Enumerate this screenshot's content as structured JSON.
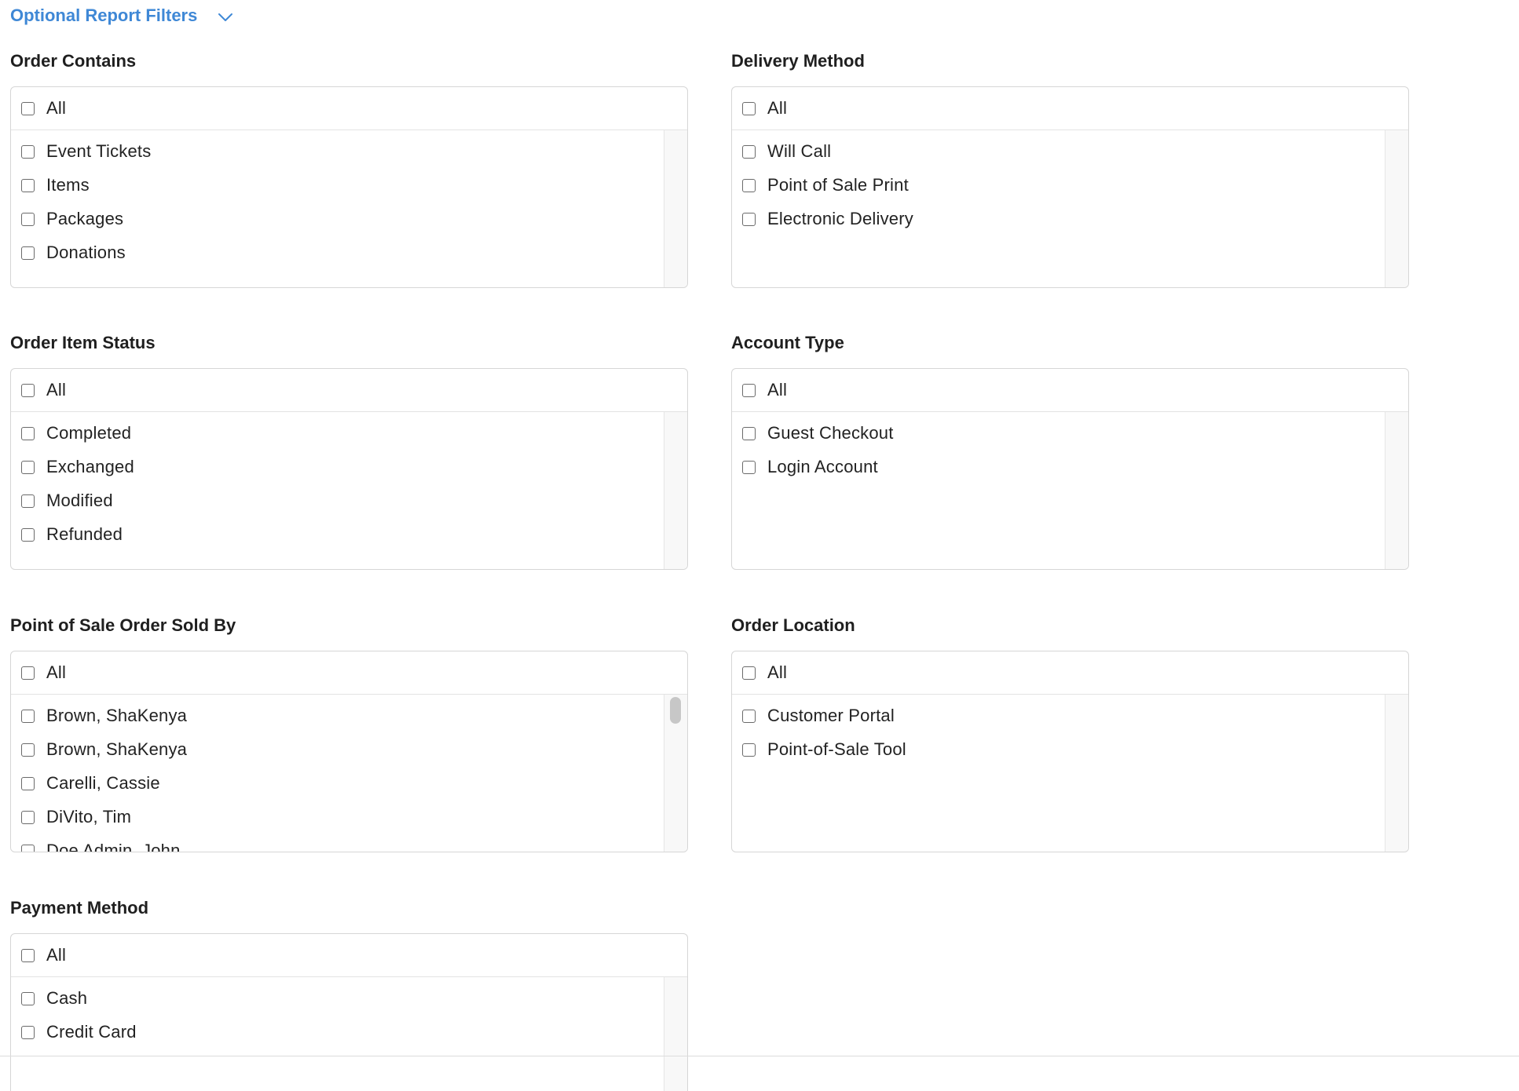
{
  "header": {
    "title": "Optional Report Filters",
    "toggle_icon": "chevron-down-icon",
    "accent_color": "#3f88d6"
  },
  "filters": {
    "order_contains": {
      "title": "Order Contains",
      "all_label": "All",
      "options": [
        "Event Tickets",
        "Items",
        "Packages",
        "Donations"
      ]
    },
    "delivery_method": {
      "title": "Delivery Method",
      "all_label": "All",
      "options": [
        "Will Call",
        "Point of Sale Print",
        "Electronic Delivery"
      ]
    },
    "order_item_status": {
      "title": "Order Item Status",
      "all_label": "All",
      "options": [
        "Completed",
        "Exchanged",
        "Modified",
        "Refunded"
      ]
    },
    "account_type": {
      "title": "Account Type",
      "all_label": "All",
      "options": [
        "Guest Checkout",
        "Login Account"
      ]
    },
    "pos_sold_by": {
      "title": "Point of Sale Order Sold By",
      "all_label": "All",
      "options": [
        "Brown, ShaKenya",
        "Brown, ShaKenya",
        "Carelli, Cassie",
        "DiVito, Tim",
        "Doe Admin, John"
      ]
    },
    "order_location": {
      "title": "Order Location",
      "all_label": "All",
      "options": [
        "Customer Portal",
        "Point-of-Sale Tool"
      ]
    },
    "payment_method": {
      "title": "Payment Method",
      "all_label": "All",
      "options": [
        "Cash",
        "Credit Card"
      ]
    }
  }
}
